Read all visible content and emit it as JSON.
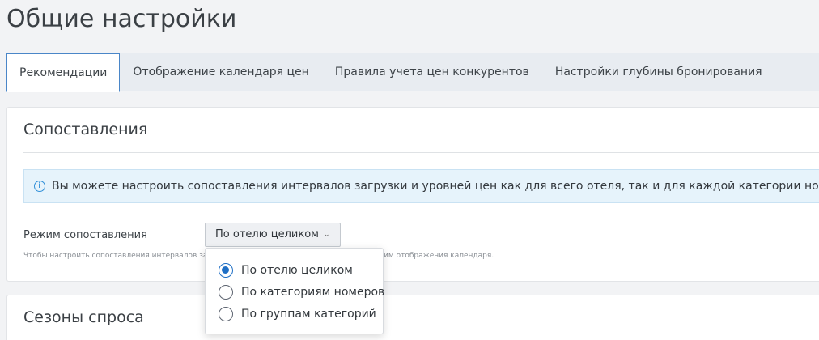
{
  "page": {
    "title": "Общие настройки"
  },
  "tabs": [
    {
      "label": "Рекомендации",
      "active": true
    },
    {
      "label": "Отображение календаря цен",
      "active": false
    },
    {
      "label": "Правила учета цен конкурентов",
      "active": false
    },
    {
      "label": "Настройки глубины бронирования",
      "active": false
    }
  ],
  "matching": {
    "title": "Сопоставления",
    "info_icon": "info-icon",
    "info_text": "Вы можете настроить сопоставления интервалов загрузки и уровней цен как для всего отеля, так и для каждой категории номера отдельно.",
    "mode_label": "Режим сопоставления",
    "dropdown_value": "По отелю целиком",
    "hint_text": "Чтобы настроить сопоставления интервалов загрузки и уровней цен, сначала измените режим отображения календаря."
  },
  "dropdown_options": [
    {
      "label": "По отелю целиком",
      "selected": true
    },
    {
      "label": "По категориям номеров",
      "selected": false
    },
    {
      "label": "По группам категорий",
      "selected": false
    }
  ],
  "seasons": {
    "title": "Сезоны спроса"
  },
  "colors": {
    "accent": "#1f6fc5",
    "info_bg": "#e6f3fb",
    "tab_border": "#4a86c8"
  }
}
